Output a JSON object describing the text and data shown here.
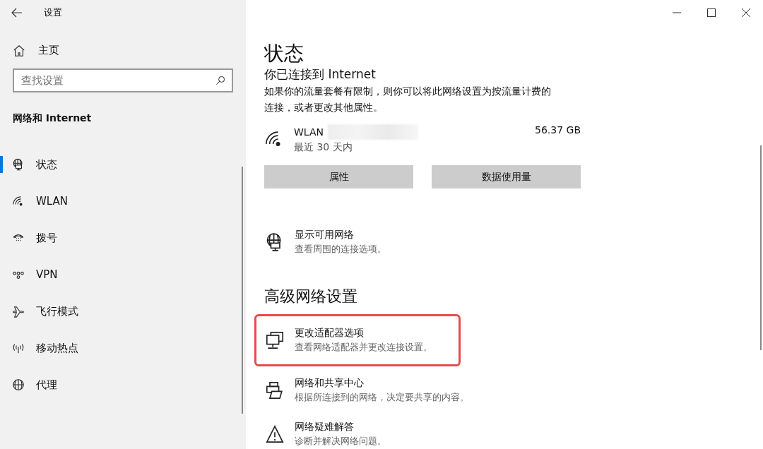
{
  "window": {
    "title": "设置"
  },
  "sidebar": {
    "home": "主页",
    "search": {
      "placeholder": "查找设置"
    },
    "section": "网络和 Internet",
    "items": [
      {
        "label": "状态",
        "kind": "status",
        "selected": true
      },
      {
        "label": "WLAN",
        "kind": "wifi",
        "selected": false
      },
      {
        "label": "拨号",
        "kind": "dialup",
        "selected": false
      },
      {
        "label": "VPN",
        "kind": "vpn",
        "selected": false
      },
      {
        "label": "飞行模式",
        "kind": "airplane",
        "selected": false
      },
      {
        "label": "移动热点",
        "kind": "hotspot",
        "selected": false
      },
      {
        "label": "代理",
        "kind": "globe",
        "selected": false
      }
    ]
  },
  "main": {
    "title": "状态",
    "connected": "你已连接到 Internet",
    "description": "如果你的流量套餐有限制，则你可以将此网络设置为按流量计费的连接，或者更改其他属性。",
    "network": {
      "name": "WLAN",
      "period": "最近 30 天内",
      "usage": "56.37 GB"
    },
    "buttons": [
      "属性",
      "数据使用量"
    ],
    "show_networks": {
      "title": "显示可用网络",
      "subtitle": "查看周围的连接选项。",
      "kind": "status",
      "highlighted": false
    },
    "advanced_heading": "高级网络设置",
    "advanced": [
      {
        "title": "更改适配器选项",
        "subtitle": "查看网络适配器并更改连接设置。",
        "kind": "adapter",
        "highlighted": true
      },
      {
        "title": "网络和共享中心",
        "subtitle": "根据所连接到的网络，决定要共享的内容。",
        "kind": "sharing",
        "highlighted": false
      },
      {
        "title": "网络疑难解答",
        "subtitle": "诊断并解决网络问题。",
        "kind": "warning",
        "highlighted": false
      }
    ]
  }
}
